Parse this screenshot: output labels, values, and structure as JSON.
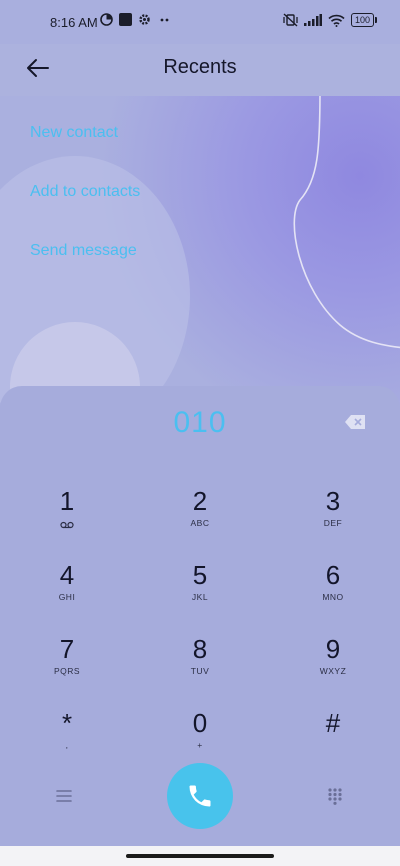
{
  "status_bar": {
    "time": "8:16 AM",
    "battery": "100"
  },
  "header": {
    "title": "Recents"
  },
  "actions": [
    {
      "label": "New contact"
    },
    {
      "label": "Add to contacts"
    },
    {
      "label": "Send message"
    }
  ],
  "dialer": {
    "number": "010",
    "keys": [
      {
        "digit": "1",
        "letters": ""
      },
      {
        "digit": "2",
        "letters": "ABC"
      },
      {
        "digit": "3",
        "letters": "DEF"
      },
      {
        "digit": "4",
        "letters": "GHI"
      },
      {
        "digit": "5",
        "letters": "JKL"
      },
      {
        "digit": "6",
        "letters": "MNO"
      },
      {
        "digit": "7",
        "letters": "PQRS"
      },
      {
        "digit": "8",
        "letters": "TUV"
      },
      {
        "digit": "9",
        "letters": "WXYZ"
      },
      {
        "digit": "*",
        "letters": ","
      },
      {
        "digit": "0",
        "letters": "+"
      },
      {
        "digit": "#",
        "letters": ""
      }
    ]
  },
  "colors": {
    "accent": "#4bbff0",
    "call_button": "#48c3ec",
    "background": "#a9afde"
  },
  "icons": [
    "back-arrow-icon",
    "backspace-icon",
    "voicemail-icon",
    "menu-icon",
    "call-icon",
    "dialpad-icon"
  ]
}
